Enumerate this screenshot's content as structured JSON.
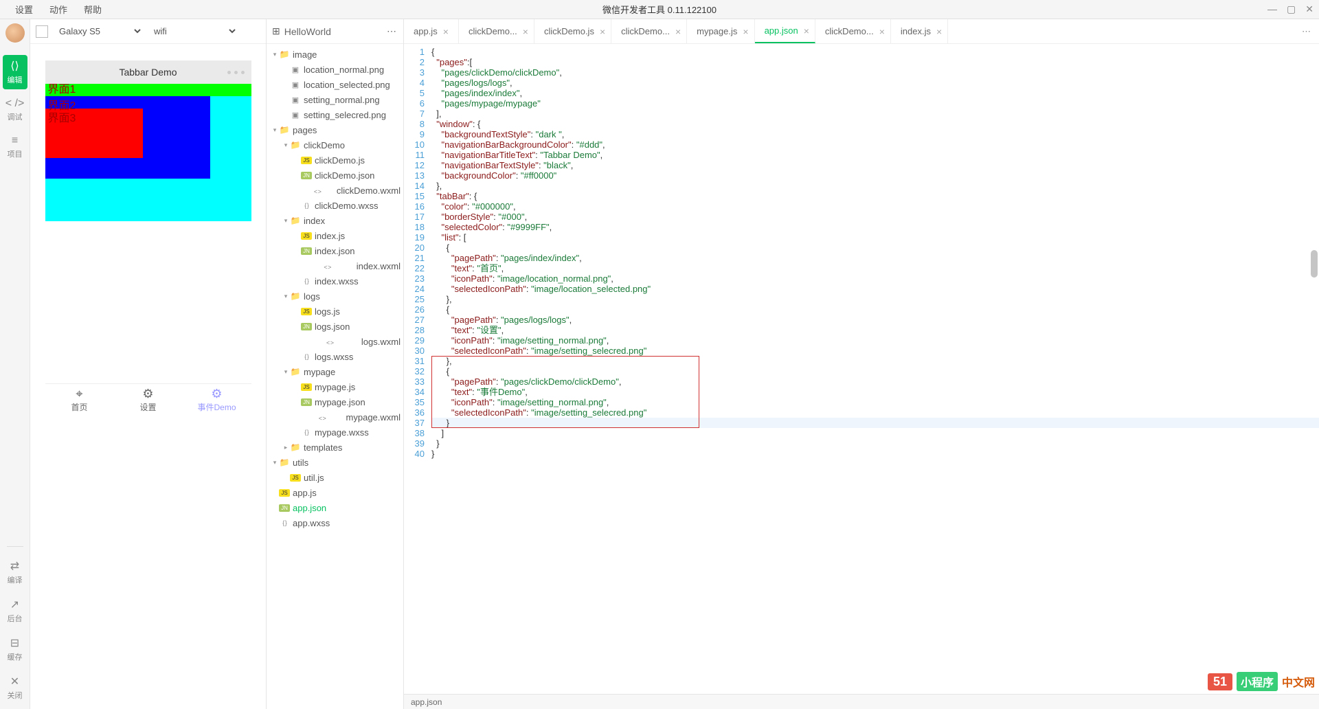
{
  "menubar": {
    "items": [
      "设置",
      "动作",
      "帮助"
    ],
    "title": "微信开发者工具 0.11.122100"
  },
  "rail": {
    "items": [
      {
        "icon": "⟨⟩",
        "label": "编辑",
        "active": true
      },
      {
        "icon": "< />",
        "label": "调试"
      },
      {
        "icon": "≡",
        "label": "项目"
      }
    ],
    "bottom": [
      {
        "icon": "⇄",
        "label": "编译"
      },
      {
        "icon": "↗",
        "label": "后台"
      },
      {
        "icon": "⊟",
        "label": "缓存"
      },
      {
        "icon": "✕",
        "label": "关闭"
      }
    ]
  },
  "simulator": {
    "device": "Galaxy S5",
    "network": "wifi",
    "headerTitle": "Tabbar Demo",
    "layers": [
      "界面1",
      "界面2",
      "界面3"
    ],
    "tabbar": [
      {
        "icon": "⌖",
        "label": "首页"
      },
      {
        "icon": "⚙",
        "label": "设置"
      },
      {
        "icon": "⚙",
        "label": "事件Demo",
        "selected": true
      }
    ]
  },
  "filetree": {
    "project": "HelloWorld",
    "nodes": [
      {
        "depth": 0,
        "type": "folder",
        "name": "image",
        "open": true
      },
      {
        "depth": 1,
        "type": "img",
        "name": "location_normal.png"
      },
      {
        "depth": 1,
        "type": "img",
        "name": "location_selected.png"
      },
      {
        "depth": 1,
        "type": "img",
        "name": "setting_normal.png"
      },
      {
        "depth": 1,
        "type": "img",
        "name": "setting_selecred.png"
      },
      {
        "depth": 0,
        "type": "folder",
        "name": "pages",
        "open": true
      },
      {
        "depth": 1,
        "type": "folder",
        "name": "clickDemo",
        "open": true
      },
      {
        "depth": 2,
        "type": "js",
        "name": "clickDemo.js"
      },
      {
        "depth": 2,
        "type": "json",
        "name": "clickDemo.json"
      },
      {
        "depth": 2,
        "type": "code",
        "name": "clickDemo.wxml"
      },
      {
        "depth": 2,
        "type": "css",
        "name": "clickDemo.wxss"
      },
      {
        "depth": 1,
        "type": "folder",
        "name": "index",
        "open": true
      },
      {
        "depth": 2,
        "type": "js",
        "name": "index.js"
      },
      {
        "depth": 2,
        "type": "json",
        "name": "index.json"
      },
      {
        "depth": 2,
        "type": "code",
        "name": "index.wxml"
      },
      {
        "depth": 2,
        "type": "css",
        "name": "index.wxss"
      },
      {
        "depth": 1,
        "type": "folder",
        "name": "logs",
        "open": true
      },
      {
        "depth": 2,
        "type": "js",
        "name": "logs.js"
      },
      {
        "depth": 2,
        "type": "json",
        "name": "logs.json"
      },
      {
        "depth": 2,
        "type": "code",
        "name": "logs.wxml"
      },
      {
        "depth": 2,
        "type": "css",
        "name": "logs.wxss"
      },
      {
        "depth": 1,
        "type": "folder",
        "name": "mypage",
        "open": true
      },
      {
        "depth": 2,
        "type": "js",
        "name": "mypage.js"
      },
      {
        "depth": 2,
        "type": "json",
        "name": "mypage.json"
      },
      {
        "depth": 2,
        "type": "code",
        "name": "mypage.wxml"
      },
      {
        "depth": 2,
        "type": "css",
        "name": "mypage.wxss"
      },
      {
        "depth": 1,
        "type": "folder",
        "name": "templates"
      },
      {
        "depth": 0,
        "type": "folder",
        "name": "utils",
        "open": true
      },
      {
        "depth": 1,
        "type": "js",
        "name": "util.js"
      },
      {
        "depth": 0,
        "type": "js",
        "name": "app.js"
      },
      {
        "depth": 0,
        "type": "json",
        "name": "app.json",
        "selected": true
      },
      {
        "depth": 0,
        "type": "css",
        "name": "app.wxss"
      }
    ]
  },
  "tabs": [
    {
      "label": "app.js"
    },
    {
      "label": "clickDemo..."
    },
    {
      "label": "clickDemo.js"
    },
    {
      "label": "clickDemo..."
    },
    {
      "label": "mypage.js"
    },
    {
      "label": "app.json",
      "active": true
    },
    {
      "label": "clickDemo..."
    },
    {
      "label": "index.js"
    }
  ],
  "code": {
    "lines": [
      [
        [
          "punc",
          "{"
        ]
      ],
      [
        [
          "sp",
          "  "
        ],
        [
          "key",
          "\"pages\""
        ],
        [
          "punc",
          ":["
        ]
      ],
      [
        [
          "sp",
          "    "
        ],
        [
          "str",
          "\"pages/clickDemo/clickDemo\""
        ],
        [
          "punc",
          ","
        ]
      ],
      [
        [
          "sp",
          "    "
        ],
        [
          "str",
          "\"pages/logs/logs\""
        ],
        [
          "punc",
          ","
        ]
      ],
      [
        [
          "sp",
          "    "
        ],
        [
          "str",
          "\"pages/index/index\""
        ],
        [
          "punc",
          ","
        ]
      ],
      [
        [
          "sp",
          "    "
        ],
        [
          "str",
          "\"pages/mypage/mypage\""
        ]
      ],
      [
        [
          "sp",
          "  "
        ],
        [
          "punc",
          "],"
        ]
      ],
      [
        [
          "sp",
          "  "
        ],
        [
          "key",
          "\"window\""
        ],
        [
          "punc",
          ": {"
        ]
      ],
      [
        [
          "sp",
          "    "
        ],
        [
          "key",
          "\"backgroundTextStyle\""
        ],
        [
          "punc",
          ": "
        ],
        [
          "str",
          "\"dark \""
        ],
        [
          "punc",
          ","
        ]
      ],
      [
        [
          "sp",
          "    "
        ],
        [
          "key",
          "\"navigationBarBackgroundColor\""
        ],
        [
          "punc",
          ": "
        ],
        [
          "str",
          "\"#ddd\""
        ],
        [
          "punc",
          ","
        ]
      ],
      [
        [
          "sp",
          "    "
        ],
        [
          "key",
          "\"navigationBarTitleText\""
        ],
        [
          "punc",
          ": "
        ],
        [
          "str",
          "\"Tabbar Demo\""
        ],
        [
          "punc",
          ","
        ]
      ],
      [
        [
          "sp",
          "    "
        ],
        [
          "key",
          "\"navigationBarTextStyle\""
        ],
        [
          "punc",
          ": "
        ],
        [
          "str",
          "\"black\""
        ],
        [
          "punc",
          ","
        ]
      ],
      [
        [
          "sp",
          "    "
        ],
        [
          "key",
          "\"backgroundColor\""
        ],
        [
          "punc",
          ": "
        ],
        [
          "str",
          "\"#ff0000\""
        ]
      ],
      [
        [
          "sp",
          "  "
        ],
        [
          "punc",
          "},"
        ]
      ],
      [
        [
          "sp",
          "  "
        ],
        [
          "key",
          "\"tabBar\""
        ],
        [
          "punc",
          ": {"
        ]
      ],
      [
        [
          "sp",
          "    "
        ],
        [
          "key",
          "\"color\""
        ],
        [
          "punc",
          ": "
        ],
        [
          "str",
          "\"#000000\""
        ],
        [
          "punc",
          ","
        ]
      ],
      [
        [
          "sp",
          "    "
        ],
        [
          "key",
          "\"borderStyle\""
        ],
        [
          "punc",
          ": "
        ],
        [
          "str",
          "\"#000\""
        ],
        [
          "punc",
          ","
        ]
      ],
      [
        [
          "sp",
          "    "
        ],
        [
          "key",
          "\"selectedColor\""
        ],
        [
          "punc",
          ": "
        ],
        [
          "str",
          "\"#9999FF\""
        ],
        [
          "punc",
          ","
        ]
      ],
      [
        [
          "sp",
          "    "
        ],
        [
          "key",
          "\"list\""
        ],
        [
          "punc",
          ": ["
        ]
      ],
      [
        [
          "sp",
          "      "
        ],
        [
          "punc",
          "{"
        ]
      ],
      [
        [
          "sp",
          "        "
        ],
        [
          "key",
          "\"pagePath\""
        ],
        [
          "punc",
          ": "
        ],
        [
          "str",
          "\"pages/index/index\""
        ],
        [
          "punc",
          ","
        ]
      ],
      [
        [
          "sp",
          "        "
        ],
        [
          "key",
          "\"text\""
        ],
        [
          "punc",
          ": "
        ],
        [
          "str",
          "\"首页\""
        ],
        [
          "punc",
          ","
        ]
      ],
      [
        [
          "sp",
          "        "
        ],
        [
          "key",
          "\"iconPath\""
        ],
        [
          "punc",
          ": "
        ],
        [
          "str",
          "\"image/location_normal.png\""
        ],
        [
          "punc",
          ","
        ]
      ],
      [
        [
          "sp",
          "        "
        ],
        [
          "key",
          "\"selectedIconPath\""
        ],
        [
          "punc",
          ": "
        ],
        [
          "str",
          "\"image/location_selected.png\""
        ]
      ],
      [
        [
          "sp",
          "      "
        ],
        [
          "punc",
          "},"
        ]
      ],
      [
        [
          "sp",
          "      "
        ],
        [
          "punc",
          "{"
        ]
      ],
      [
        [
          "sp",
          "        "
        ],
        [
          "key",
          "\"pagePath\""
        ],
        [
          "punc",
          ": "
        ],
        [
          "str",
          "\"pages/logs/logs\""
        ],
        [
          "punc",
          ","
        ]
      ],
      [
        [
          "sp",
          "        "
        ],
        [
          "key",
          "\"text\""
        ],
        [
          "punc",
          ": "
        ],
        [
          "str",
          "\"设置\""
        ],
        [
          "punc",
          ","
        ]
      ],
      [
        [
          "sp",
          "        "
        ],
        [
          "key",
          "\"iconPath\""
        ],
        [
          "punc",
          ": "
        ],
        [
          "str",
          "\"image/setting_normal.png\""
        ],
        [
          "punc",
          ","
        ]
      ],
      [
        [
          "sp",
          "        "
        ],
        [
          "key",
          "\"selectedIconPath\""
        ],
        [
          "punc",
          ": "
        ],
        [
          "str",
          "\"image/setting_selecred.png\""
        ]
      ],
      [
        [
          "sp",
          "      "
        ],
        [
          "punc",
          "},"
        ]
      ],
      [
        [
          "sp",
          "      "
        ],
        [
          "punc",
          "{"
        ]
      ],
      [
        [
          "sp",
          "        "
        ],
        [
          "key",
          "\"pagePath\""
        ],
        [
          "punc",
          ": "
        ],
        [
          "str",
          "\"pages/clickDemo/clickDemo\""
        ],
        [
          "punc",
          ","
        ]
      ],
      [
        [
          "sp",
          "        "
        ],
        [
          "key",
          "\"text\""
        ],
        [
          "punc",
          ": "
        ],
        [
          "str",
          "\"事件Demo\""
        ],
        [
          "punc",
          ","
        ]
      ],
      [
        [
          "sp",
          "        "
        ],
        [
          "key",
          "\"iconPath\""
        ],
        [
          "punc",
          ": "
        ],
        [
          "str",
          "\"image/setting_normal.png\""
        ],
        [
          "punc",
          ","
        ]
      ],
      [
        [
          "sp",
          "        "
        ],
        [
          "key",
          "\"selectedIconPath\""
        ],
        [
          "punc",
          ": "
        ],
        [
          "str",
          "\"image/setting_selecred.png\""
        ]
      ],
      [
        [
          "sp",
          "      "
        ],
        [
          "punc",
          "}"
        ]
      ],
      [
        [
          "sp",
          "    "
        ],
        [
          "punc",
          "]"
        ]
      ],
      [
        [
          "sp",
          "  "
        ],
        [
          "punc",
          "}"
        ]
      ],
      [
        [
          "punc",
          "}"
        ]
      ]
    ],
    "cursorLine": 37,
    "highlightBox": {
      "startLine": 31,
      "endLine": 37
    }
  },
  "statusbar": {
    "file": "app.json"
  },
  "watermark": {
    "a": "51",
    "b": "小程序",
    "c": "中文网"
  }
}
